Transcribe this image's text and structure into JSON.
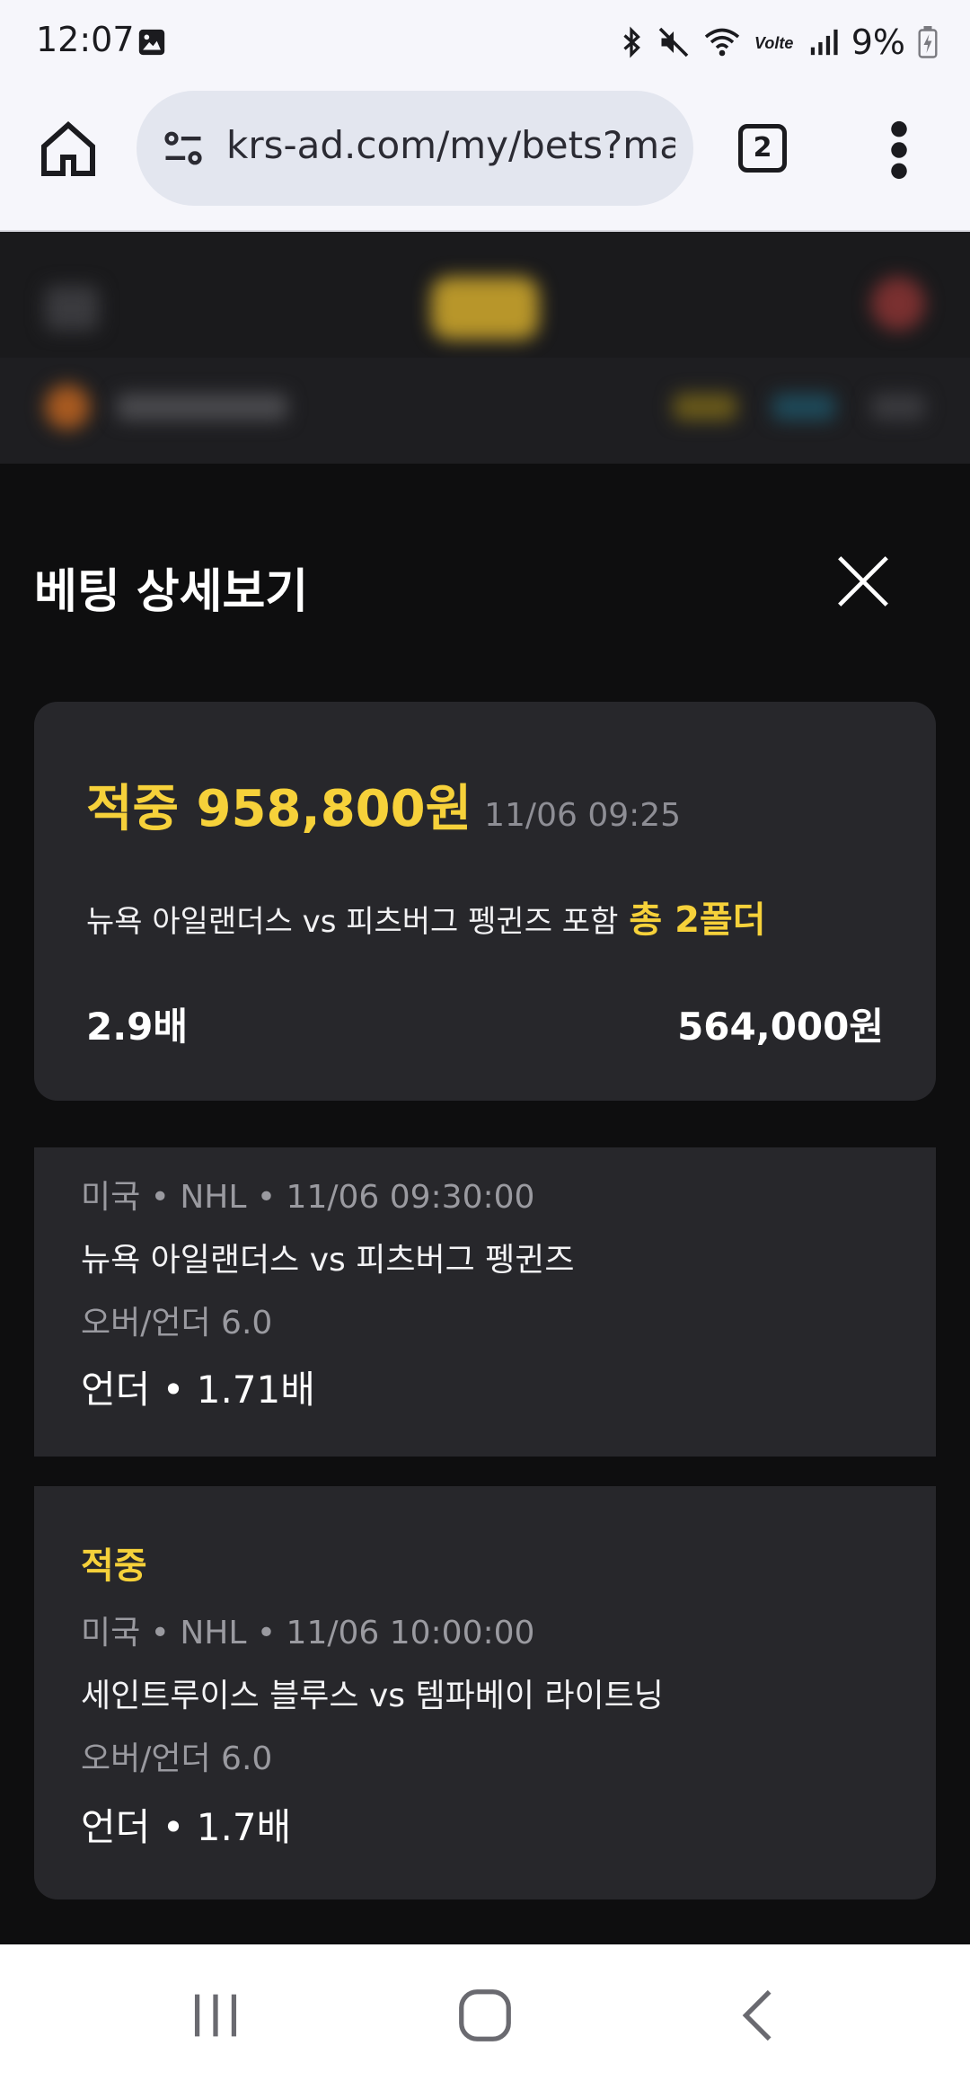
{
  "status_bar": {
    "time": "12:07",
    "battery_percent": "9%",
    "icons": [
      "image-icon",
      "bluetooth-icon",
      "mute-icon",
      "wifi-icon",
      "volte-icon",
      "signal-icon",
      "battery-charging-icon"
    ]
  },
  "browser": {
    "url": "krs-ad.com/my/bets?ma",
    "tab_count": "2"
  },
  "sheet": {
    "title": "베팅 상세보기",
    "summary": {
      "result_amount": "적중 958,800원",
      "timestamp": "11/06 09:25",
      "match_text": "뉴욕 아일랜더스 vs 피츠버그 펭귄즈 포함",
      "folder_count": "총 2폴더",
      "total_odds": "2.9배",
      "stake": "564,000원"
    },
    "legs": [
      {
        "status": "",
        "meta": "미국 • NHL • 11/06 09:30:00",
        "teams": "뉴욕 아일랜더스 vs 피츠버그 펭귄즈",
        "market": "오버/언더 6.0",
        "pick": "언더 • 1.71배"
      },
      {
        "status": "적중",
        "meta": "미국 • NHL • 11/06 10:00:00",
        "teams": "세인트루이스 블루스 vs 템파베이 라이트닝",
        "market": "오버/언더 6.0",
        "pick": "언더 • 1.7배"
      }
    ]
  },
  "colors": {
    "accent_yellow": "#f6d13a",
    "card_bg": "#27272b",
    "sheet_bg": "#0e0e0f"
  }
}
